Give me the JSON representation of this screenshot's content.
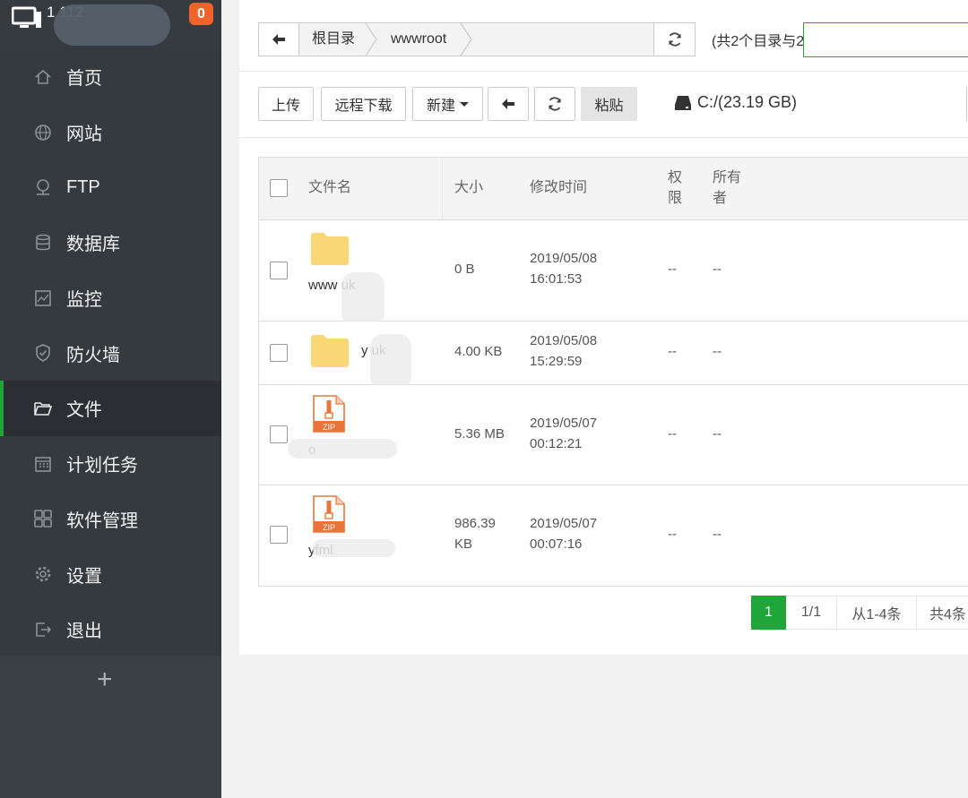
{
  "server": {
    "ip": "1        112",
    "badge": "0"
  },
  "menu": [
    {
      "label": "首页",
      "icon": "home-icon"
    },
    {
      "label": "网站",
      "icon": "globe-icon"
    },
    {
      "label": "FTP",
      "icon": "ftp-icon"
    },
    {
      "label": "数据库",
      "icon": "database-icon"
    },
    {
      "label": "监控",
      "icon": "monitor-chart-icon"
    },
    {
      "label": "防火墙",
      "icon": "shield-icon"
    },
    {
      "label": "文件",
      "icon": "folder-icon",
      "active": true
    },
    {
      "label": "计划任务",
      "icon": "calendar-icon"
    },
    {
      "label": "软件管理",
      "icon": "grid-icon"
    },
    {
      "label": "设置",
      "icon": "gear-icon"
    },
    {
      "label": "退出",
      "icon": "logout-icon"
    }
  ],
  "add_label": "+",
  "path": {
    "root": "根目录",
    "current": "wwwroot"
  },
  "summary": "(共2个目录与2",
  "toolbar": {
    "upload": "上传",
    "remote_download": "远程下载",
    "new": "新建",
    "paste": "粘贴"
  },
  "disk": "C:/(23.19 GB)",
  "table": {
    "headers": {
      "name": "文件名",
      "size": "大小",
      "mtime": "修改时间",
      "perm": "权限",
      "owner": "所有者"
    },
    "rows": [
      {
        "type": "folder",
        "name": "www        uk",
        "size": "0 B",
        "date": "2019/05/08",
        "time": "16:01:53",
        "perm": "--",
        "owner": "--"
      },
      {
        "type": "folder",
        "name": "y        uk",
        "size": "4.00 KB",
        "date": "2019/05/08",
        "time": "15:29:59",
        "perm": "--",
        "owner": "--"
      },
      {
        "type": "zip",
        "name": "            o",
        "size": "5.36 MB",
        "date": "2019/05/07",
        "time": "00:12:21",
        "perm": "--",
        "owner": "--"
      },
      {
        "type": "zip",
        "name": "yfml",
        "size": "986.39 KB",
        "date": "2019/05/07",
        "time": "00:07:16",
        "perm": "--",
        "owner": "--"
      }
    ]
  },
  "pager": {
    "current": "1",
    "pages": "1/1",
    "range": "从1-4条",
    "total": "共4条"
  },
  "colors": {
    "accent": "#20a53a",
    "sidebar": "#3a4046",
    "badge": "#f0632a",
    "folder": "#f8d775",
    "zip": "#e8743b"
  }
}
